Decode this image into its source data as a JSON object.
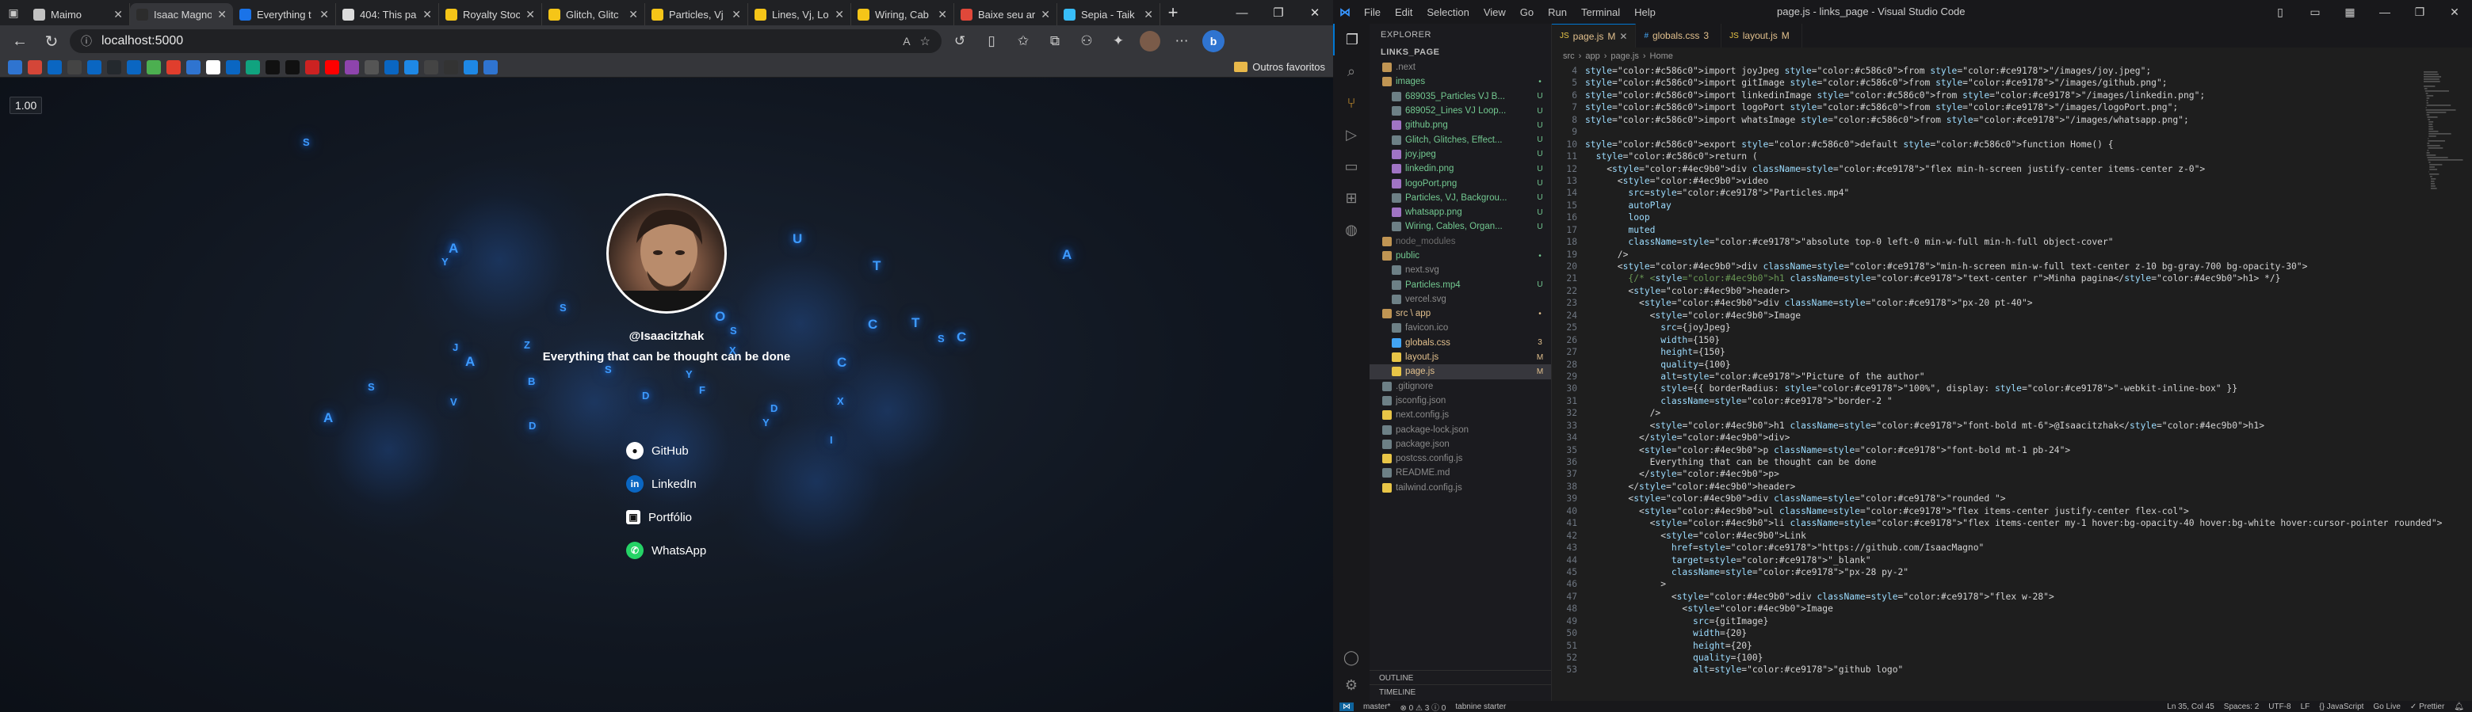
{
  "browser": {
    "tabs": [
      {
        "title": "Maimo",
        "color": "#c2c2c2",
        "active": false
      },
      {
        "title": "Isaac Magno",
        "color": "#2c2c2c",
        "active": true
      },
      {
        "title": "Everything t",
        "color": "#1a73e8",
        "active": false
      },
      {
        "title": "404: This pa",
        "color": "#dcdcdc",
        "active": false
      },
      {
        "title": "Royalty Stoc",
        "color": "#f5c518",
        "active": false
      },
      {
        "title": "Glitch, Glitc",
        "color": "#f5c518",
        "active": false
      },
      {
        "title": "Particles, Vj",
        "color": "#f5c518",
        "active": false
      },
      {
        "title": "Lines, Vj, Lo",
        "color": "#f5c518",
        "active": false
      },
      {
        "title": "Wiring, Cab",
        "color": "#f5c518",
        "active": false
      },
      {
        "title": "Baixe seu ar",
        "color": "#e0483a",
        "active": false
      },
      {
        "title": "Sepia - Taik",
        "color": "#38bdf8",
        "active": false
      }
    ],
    "new_tab": "+",
    "window_controls": {
      "minimize": "—",
      "restore": "❐",
      "close": "✕"
    },
    "url": "localhost:5000",
    "bookmarks_folder": "Outros favoritos",
    "bookmark_colors": [
      "#2f74d0",
      "#d44638",
      "#0a66c2",
      "#444",
      "#0a66c2",
      "#24292e",
      "#0a66c2",
      "#4caf50",
      "#e03e2d",
      "#2f74d0",
      "#fff",
      "#0a66c2",
      "#10a37f",
      "#111",
      "#111",
      "#cc2222",
      "#ff0000",
      "#8e44ad",
      "#555",
      "#0a66c2",
      "#1e88e5",
      "#444",
      "#333",
      "#1e88e5",
      "#2f74d0"
    ],
    "page": {
      "zoom_badge": "1.00",
      "username": "@Isaacitzhak",
      "tagline": "Everything that can be thought can be done",
      "links": [
        {
          "label": "GitHub",
          "icon": "github-icon"
        },
        {
          "label": "LinkedIn",
          "icon": "linkedin-icon"
        },
        {
          "label": "Portfólio",
          "icon": "briefcase-icon"
        },
        {
          "label": "WhatsApp",
          "icon": "whatsapp-icon"
        }
      ],
      "floating_letters": [
        "S",
        "A",
        "Y",
        "U",
        "T",
        "A",
        "c",
        "O",
        "S",
        "S",
        "C",
        "T",
        "C",
        "S",
        "J",
        "Z",
        "A",
        "X",
        "C",
        "S",
        "Y",
        "B",
        "S",
        "F",
        "D",
        "V",
        "D",
        "X",
        "A",
        "Y",
        "D",
        "I"
      ]
    }
  },
  "vscode": {
    "menus": [
      "File",
      "Edit",
      "Selection",
      "View",
      "Go",
      "Run",
      "Terminal",
      "Help"
    ],
    "title": "page.js - links_page - Visual Studio Code",
    "explorer_title": "EXPLORER",
    "project": "LINKS_PAGE",
    "tree": [
      {
        "label": ".next",
        "depth": 1,
        "color": "#8a8a8a",
        "badge": "",
        "kind": "folder"
      },
      {
        "label": "images",
        "depth": 1,
        "color": "#73c991",
        "badge": "•",
        "kind": "folder"
      },
      {
        "label": "689035_Particles VJ B...",
        "depth": 2,
        "color": "#73c991",
        "badge": "U",
        "kind": "file"
      },
      {
        "label": "689052_Lines VJ Loop...",
        "depth": 2,
        "color": "#73c991",
        "badge": "U",
        "kind": "file"
      },
      {
        "label": "github.png",
        "depth": 2,
        "color": "#73c991",
        "badge": "U",
        "kind": "file"
      },
      {
        "label": "Glitch, Glitches, Effect...",
        "depth": 2,
        "color": "#73c991",
        "badge": "U",
        "kind": "file"
      },
      {
        "label": "joy.jpeg",
        "depth": 2,
        "color": "#73c991",
        "badge": "U",
        "kind": "file"
      },
      {
        "label": "linkedin.png",
        "depth": 2,
        "color": "#73c991",
        "badge": "U",
        "kind": "file"
      },
      {
        "label": "logoPort.png",
        "depth": 2,
        "color": "#73c991",
        "badge": "U",
        "kind": "file"
      },
      {
        "label": "Particles, VJ, Backgrou...",
        "depth": 2,
        "color": "#73c991",
        "badge": "U",
        "kind": "file"
      },
      {
        "label": "whatsapp.png",
        "depth": 2,
        "color": "#73c991",
        "badge": "U",
        "kind": "file"
      },
      {
        "label": "Wiring, Cables, Organ...",
        "depth": 2,
        "color": "#73c991",
        "badge": "U",
        "kind": "file"
      },
      {
        "label": "node_modules",
        "depth": 1,
        "color": "#6b6b6b",
        "badge": "",
        "kind": "folder"
      },
      {
        "label": "public",
        "depth": 1,
        "color": "#73c991",
        "badge": "•",
        "kind": "folder"
      },
      {
        "label": "next.svg",
        "depth": 2,
        "color": "#8a8a8a",
        "badge": "",
        "kind": "file"
      },
      {
        "label": "Particles.mp4",
        "depth": 2,
        "color": "#73c991",
        "badge": "U",
        "kind": "file"
      },
      {
        "label": "vercel.svg",
        "depth": 2,
        "color": "#8a8a8a",
        "badge": "",
        "kind": "file"
      },
      {
        "label": "src \\ app",
        "depth": 1,
        "color": "#e2c08d",
        "badge": "•",
        "kind": "folder"
      },
      {
        "label": "favicon.ico",
        "depth": 2,
        "color": "#8a8a8a",
        "badge": "",
        "kind": "file"
      },
      {
        "label": "globals.css",
        "depth": 2,
        "color": "#e2c08d",
        "badge": "3",
        "kind": "file"
      },
      {
        "label": "layout.js",
        "depth": 2,
        "color": "#e2c08d",
        "badge": "M",
        "kind": "file"
      },
      {
        "label": "page.js",
        "depth": 2,
        "color": "#e2c08d",
        "badge": "M",
        "kind": "file",
        "selected": true
      },
      {
        "label": ".gitignore",
        "depth": 1,
        "color": "#8a8a8a",
        "badge": "",
        "kind": "file"
      },
      {
        "label": "jsconfig.json",
        "depth": 1,
        "color": "#8a8a8a",
        "badge": "",
        "kind": "file"
      },
      {
        "label": "next.config.js",
        "depth": 1,
        "color": "#8a8a8a",
        "badge": "",
        "kind": "file"
      },
      {
        "label": "package-lock.json",
        "depth": 1,
        "color": "#8a8a8a",
        "badge": "",
        "kind": "file"
      },
      {
        "label": "package.json",
        "depth": 1,
        "color": "#8a8a8a",
        "badge": "",
        "kind": "file"
      },
      {
        "label": "postcss.config.js",
        "depth": 1,
        "color": "#8a8a8a",
        "badge": "",
        "kind": "file"
      },
      {
        "label": "README.md",
        "depth": 1,
        "color": "#8a8a8a",
        "badge": "",
        "kind": "file"
      },
      {
        "label": "tailwind.config.js",
        "depth": 1,
        "color": "#8a8a8a",
        "badge": "",
        "kind": "file"
      }
    ],
    "outline_label": "OUTLINE",
    "timeline_label": "TIMELINE",
    "editor_tabs": [
      {
        "label": "page.js",
        "badge": "M",
        "active": true
      },
      {
        "label": "globals.css",
        "badge": "3",
        "active": false
      },
      {
        "label": "layout.js",
        "badge": "M",
        "active": false
      }
    ],
    "breadcrumbs": [
      "src",
      "app",
      "page.js",
      "Home"
    ],
    "code_start_line": 4,
    "code": [
      "import joyJpeg from \"/images/joy.jpeg\";",
      "import gitImage from \"/images/github.png\";",
      "import linkedinImage from \"/images/linkedin.png\";",
      "import logoPort from \"/images/logoPort.png\";",
      "import whatsImage from \"/images/whatsapp.png\";",
      "",
      "export default function Home() {",
      "  return (",
      "    <div className=\"flex min-h-screen justify-center items-center z-0\">",
      "      <video",
      "        src=\"Particles.mp4\"",
      "        autoPlay",
      "        loop",
      "        muted",
      "        className=\"absolute top-0 left-0 min-w-full min-h-full object-cover\"",
      "      />",
      "      <div className=\"min-h-screen min-w-full text-center z-10 bg-gray-700 bg-opacity-30\">",
      "        {/* <h1 className=\"text-center r\">Minha pagina</h1> */}",
      "        <header>",
      "          <div className=\"px-20 pt-40\">",
      "            <Image",
      "              src={joyJpeg}",
      "              width={150}",
      "              height={150}",
      "              quality={100}",
      "              alt=\"Picture of the author\"",
      "              style={{ borderRadius: \"100%\", display: \"-webkit-inline-box\" }}",
      "              className=\"border-2 \"",
      "            />",
      "            <h1 className=\"font-bold mt-6\">@Isaacitzhak</h1>",
      "          </div>",
      "          <p className=\"font-bold mt-1 pb-24\">",
      "            Everything that can be thought can be done",
      "          </p>",
      "        </header>",
      "        <div className=\"rounded \">",
      "          <ul className=\"flex items-center justify-center flex-col\">",
      "            <li className=\"flex items-center my-1 hover:bg-opacity-40 hover:bg-white hover:cursor-pointer rounded\">",
      "              <Link",
      "                href=\"https://github.com/IsaacMagno\"",
      "                target=\"_blank\"",
      "                className=\"px-28 py-2\"",
      "              >",
      "                <div className=\"flex w-28\">",
      "                  <Image",
      "                    src={gitImage}",
      "                    width={20}",
      "                    height={20}",
      "                    quality={100}",
      "                    alt=\"github logo\""
    ],
    "status": {
      "branch": "master*",
      "problems": "⊗ 0  ⚠ 3  ⓘ 0",
      "extension": "tabnine starter",
      "position": "Ln 35, Col 45",
      "spaces": "Spaces: 2",
      "encoding": "UTF-8",
      "eol": "LF",
      "language": "{} JavaScript",
      "golive": "Go Live",
      "prettier": "✓ Prettier"
    }
  }
}
